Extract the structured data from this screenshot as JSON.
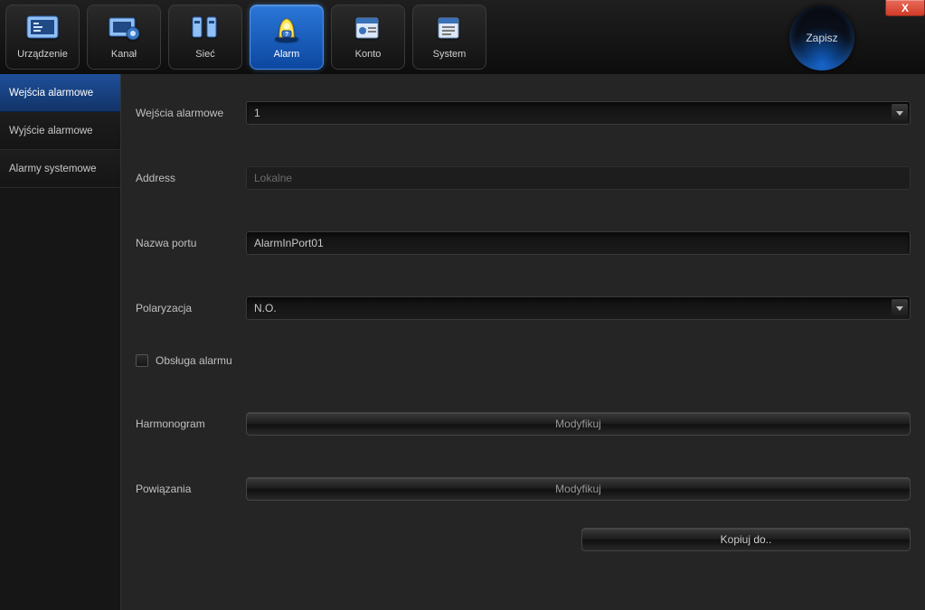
{
  "topbar": {
    "nav": [
      {
        "icon": "device",
        "label": "Urządzenie",
        "active": false
      },
      {
        "icon": "channel",
        "label": "Kanał",
        "active": false
      },
      {
        "icon": "network",
        "label": "Sieć",
        "active": false
      },
      {
        "icon": "alarm",
        "label": "Alarm",
        "active": true
      },
      {
        "icon": "account",
        "label": "Konto",
        "active": false
      },
      {
        "icon": "system",
        "label": "System",
        "active": false
      }
    ],
    "save_label": "Zapisz",
    "close_label": "X"
  },
  "sidebar": {
    "items": [
      {
        "label": "Wejścia alarmowe",
        "active": true
      },
      {
        "label": "Wyjście alarmowe",
        "active": false
      },
      {
        "label": "Alarmy systemowe",
        "active": false
      }
    ]
  },
  "form": {
    "alarm_inputs": {
      "label": "Wejścia alarmowe",
      "value": "1"
    },
    "address": {
      "label": "Address",
      "value": "Lokalne"
    },
    "port_name": {
      "label": "Nazwa portu",
      "value": "AlarmInPort01"
    },
    "polarization": {
      "label": "Polaryzacja",
      "value": "N.O."
    },
    "alarm_handling": {
      "label": "Obsługa alarmu",
      "checked": false
    },
    "schedule": {
      "label": "Harmonogram",
      "button": "Modyfikuj"
    },
    "linkage": {
      "label": "Powiązania",
      "button": "Modyfikuj"
    },
    "copy_to": {
      "label": "Kopiuj do.."
    }
  }
}
